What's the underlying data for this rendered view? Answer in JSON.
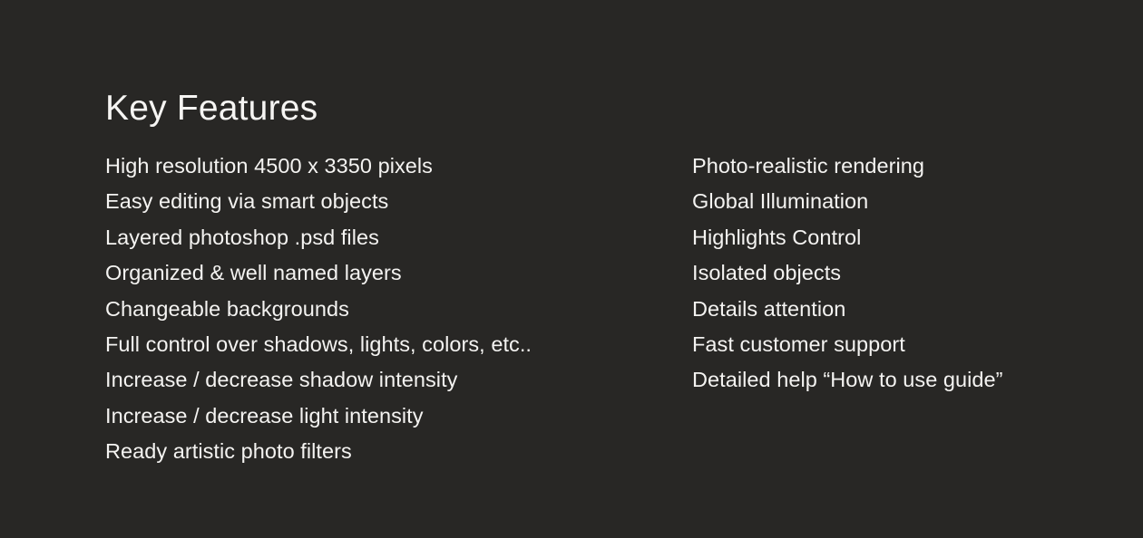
{
  "slide": {
    "title": "Key Features",
    "background_color": "#282725",
    "text_color": "#f4f3f1",
    "title_color": "#f6f5f3"
  },
  "columns": {
    "left": {
      "items": [
        "High resolution 4500 x 3350 pixels",
        "Easy editing via smart objects",
        "Layered photoshop .psd files",
        "Organized & well named layers",
        "Changeable backgrounds",
        "Full control over shadows, lights, colors, etc..",
        "Increase / decrease shadow intensity",
        "Increase / decrease light intensity",
        "Ready artistic photo filters"
      ]
    },
    "right": {
      "items": [
        "Photo-realistic rendering",
        "Global Illumination",
        "Highlights Control",
        "Isolated objects",
        "Details attention",
        "Fast customer support",
        "Detailed help “How to use guide”"
      ]
    }
  }
}
